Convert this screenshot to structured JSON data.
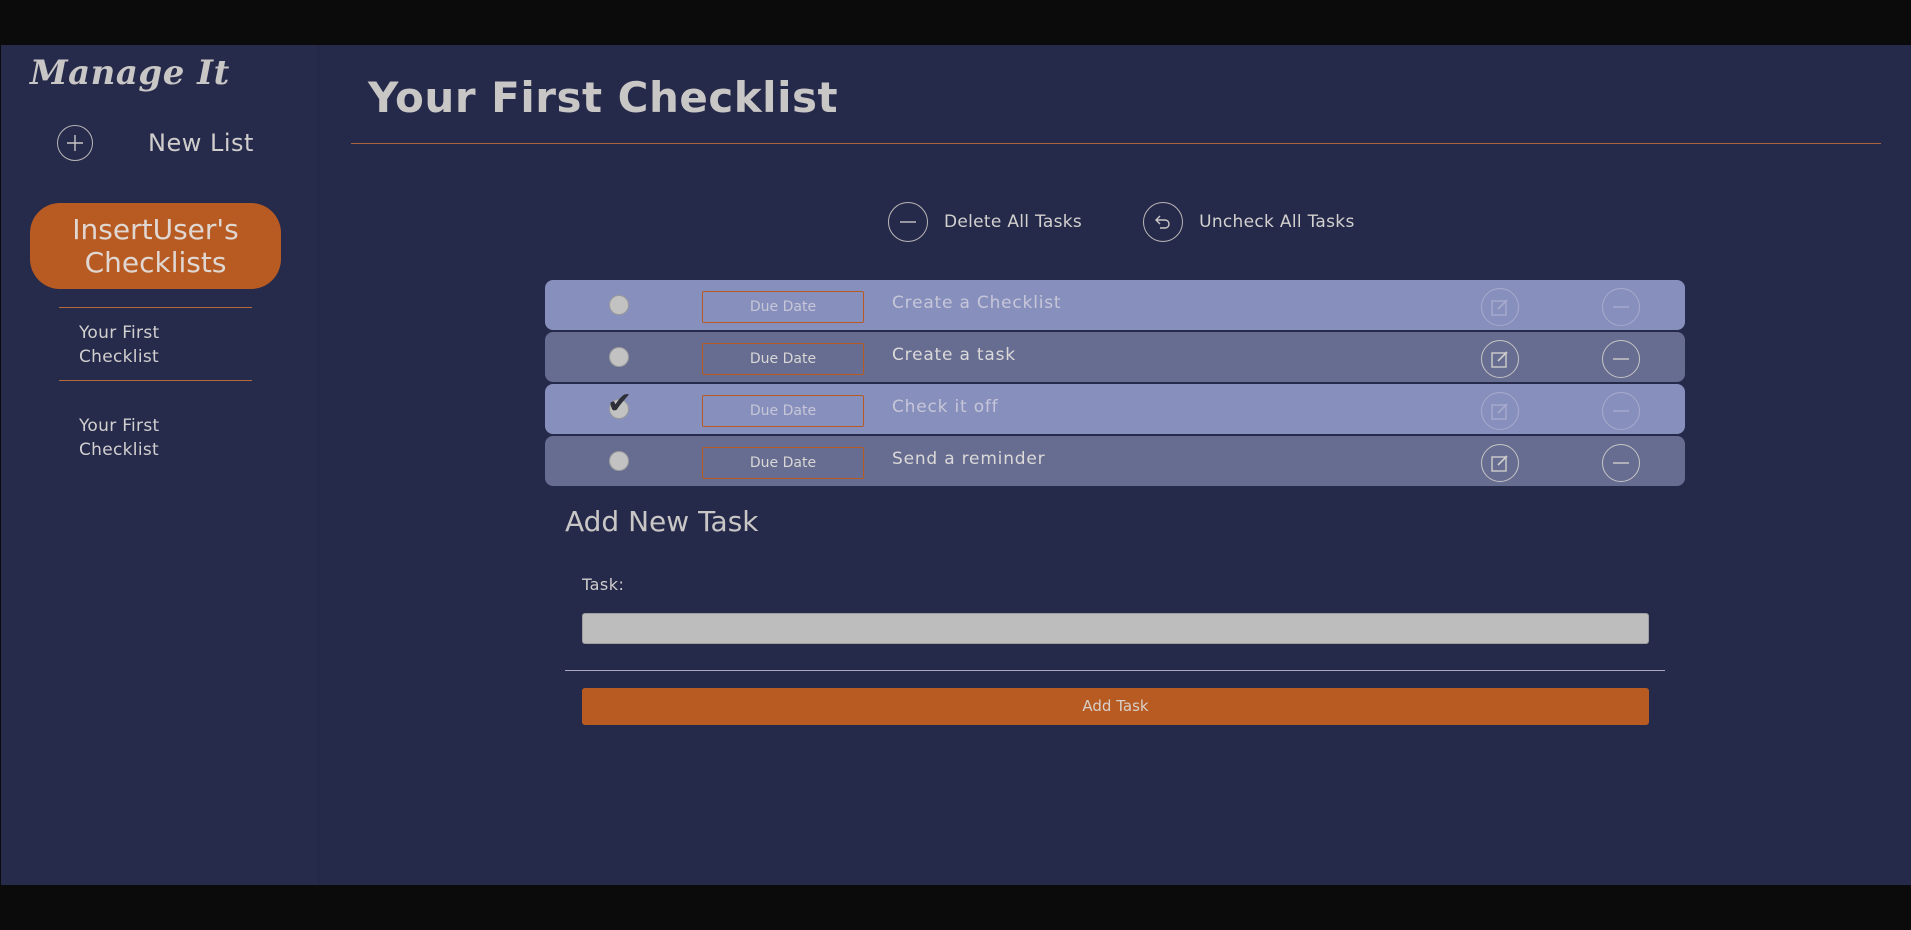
{
  "sidebar": {
    "brand": "Manage It",
    "new_list_label": "New List",
    "user_badge": "InsertUser's Checklists",
    "lists": [
      {
        "label": "Your First Checklist"
      },
      {
        "label": "Your First Checklist"
      }
    ]
  },
  "main": {
    "title": "Your First Checklist",
    "actions": {
      "delete_all": "Delete All Tasks",
      "uncheck_all": "Uncheck All Tasks"
    },
    "tasks": [
      {
        "text": "Create a Checklist",
        "due_placeholder": "Due Date",
        "checked": false,
        "style": "light"
      },
      {
        "text": "Create a task",
        "due_placeholder": "Due Date",
        "checked": false,
        "style": "dark"
      },
      {
        "text": "Check it off",
        "due_placeholder": "Due Date",
        "checked": true,
        "style": "light"
      },
      {
        "text": "Send a reminder",
        "due_placeholder": "Due Date",
        "checked": false,
        "style": "dark"
      }
    ],
    "add_task": {
      "title": "Add New Task",
      "task_label": "Task:",
      "task_value": "",
      "button_label": "Add Task"
    }
  },
  "colors": {
    "background": "#262a4a",
    "accent": "#b85b22",
    "row_light": "#8790bd",
    "row_dark": "#666d91"
  },
  "icons": {
    "new_list": "plus-circle-icon",
    "delete_all": "minus-circle-icon",
    "uncheck_all": "undo-circle-icon",
    "edit": "edit-icon",
    "delete": "minus-circle-icon",
    "checked": "checkmark-icon"
  }
}
